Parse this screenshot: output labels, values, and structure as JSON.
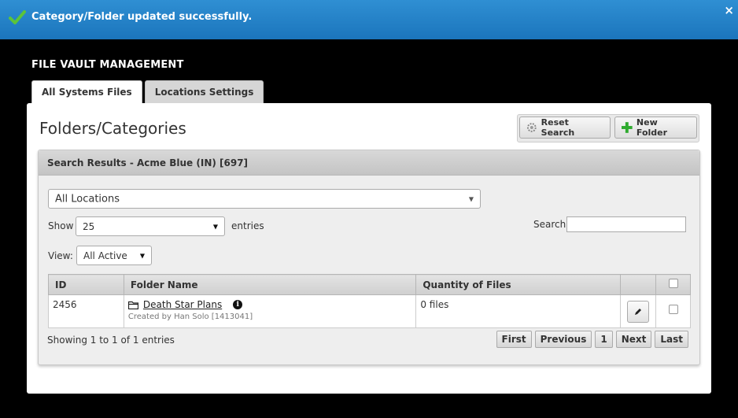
{
  "notification": {
    "message": "Category/Folder updated successfully.",
    "close": "×",
    "color": "#1b75bc",
    "icon": "check-icon"
  },
  "app": {
    "title": "FILE VAULT MANAGEMENT"
  },
  "tabs": [
    {
      "label": "All Systems Files",
      "active": true
    },
    {
      "label": "Locations Settings",
      "active": false
    }
  ],
  "panel": {
    "heading": "Folders/Categories",
    "reset_label": "Reset Search",
    "new_folder_label": "New Folder"
  },
  "results": {
    "header": "Search Results - Acme Blue (IN) [697]",
    "location_select": "All Locations",
    "show_label": "Show",
    "entries_value": "25",
    "entries_label": "entries",
    "view_label": "View:",
    "view_value": "All Active",
    "search_label": "Search:",
    "search_value": ""
  },
  "table": {
    "columns": [
      "ID",
      "Folder Name",
      "Quantity of Files"
    ],
    "rows": [
      {
        "id": "2456",
        "folder_name": "Death Star Plans",
        "created_by": "Created by Han Solo [1413041]",
        "quantity": "0 files"
      }
    ]
  },
  "footer": {
    "info": "Showing 1 to 1 of 1 entries",
    "first": "First",
    "previous": "Previous",
    "page": "1",
    "next": "Next",
    "last": "Last"
  }
}
